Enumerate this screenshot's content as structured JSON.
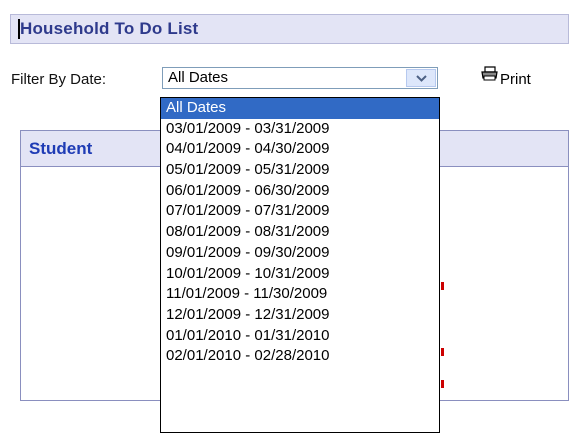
{
  "title": "Household To Do List",
  "filter": {
    "label": "Filter By Date:",
    "selected": "All Dates",
    "options": [
      "All Dates",
      "03/01/2009 - 03/31/2009",
      "04/01/2009 - 04/30/2009",
      "05/01/2009 - 05/31/2009",
      "06/01/2009 - 06/30/2009",
      "07/01/2009 - 07/31/2009",
      "08/01/2009 - 08/31/2009",
      "09/01/2009 - 09/30/2009",
      "10/01/2009 - 10/31/2009",
      "11/01/2009 - 11/30/2009",
      "12/01/2009 - 12/31/2009",
      "01/01/2010 - 01/31/2010",
      "02/01/2010 - 02/28/2010"
    ]
  },
  "print": {
    "label": "Print",
    "icon": "printer-icon"
  },
  "student_panel": {
    "header": "Student"
  },
  "colors": {
    "header_bg": "#e3e4f5",
    "title": "#2e3a8c",
    "student_title": "#1f3cb5",
    "selection": "#316ac5"
  }
}
